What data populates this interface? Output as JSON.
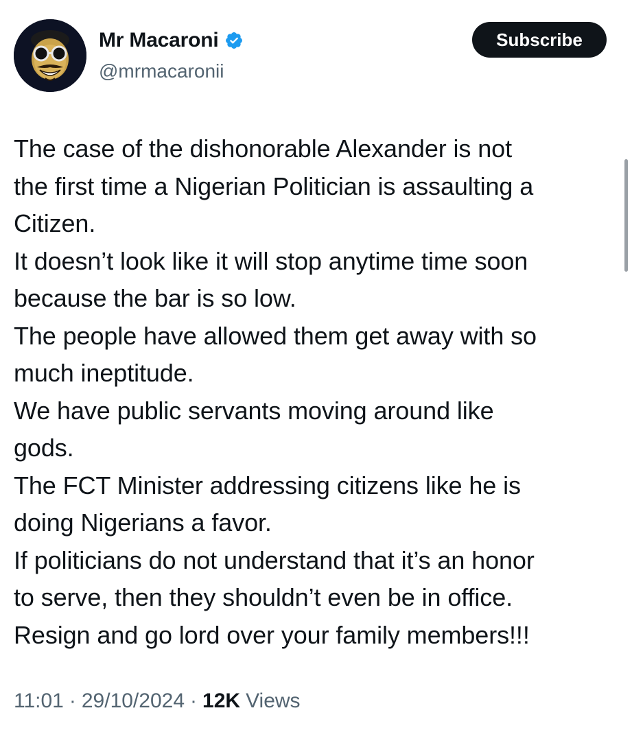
{
  "author": {
    "display_name": "Mr Macaroni",
    "handle": "@mrmacaronii",
    "verified": true,
    "avatar_icon": "cartoon-avatar-with-sunglasses"
  },
  "actions": {
    "subscribe_label": "Subscribe"
  },
  "tweet": {
    "lines": [
      "The case of the dishonorable Alexander is not",
      "the first time a Nigerian Politician is assaulting a",
      "Citizen.",
      "It doesn’t look like it will stop anytime time soon",
      "because the bar is so low.",
      "The people have allowed them get away with so",
      "much ineptitude.",
      "We have public servants moving around like",
      "gods.",
      "The FCT Minister addressing citizens like he is",
      "doing Nigerians a favor.",
      "If politicians do not understand that it’s an honor",
      "to serve, then they shouldn’t even be in office.",
      "Resign and go lord over your family members!!!"
    ]
  },
  "meta": {
    "time": "11:01",
    "date": "29/10/2024",
    "separator": "·",
    "views_count": "12K",
    "views_label": "Views"
  },
  "colors": {
    "text": "#0f1419",
    "secondary": "#536471",
    "verified_blue": "#1d9bf0",
    "button_bg": "#0f1419"
  }
}
